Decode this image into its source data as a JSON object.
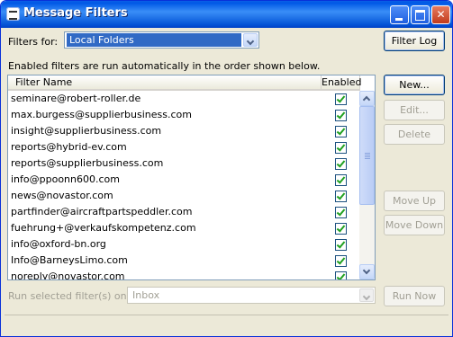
{
  "window": {
    "title": "Message Filters",
    "app_icon": "thunderbird-filter-icon"
  },
  "filters_for": {
    "label": "Filters for:",
    "selected": "Local Folders"
  },
  "filter_log_button": "Filter Log",
  "description": "Enabled filters are run automatically in the order shown below.",
  "list": {
    "columns": {
      "name": "Filter Name",
      "enabled": "Enabled"
    },
    "rows": [
      {
        "name": "seminare@robert-roller.de",
        "enabled": true
      },
      {
        "name": "max.burgess@supplierbusiness.com",
        "enabled": true
      },
      {
        "name": "insight@supplierbusiness.com",
        "enabled": true
      },
      {
        "name": "reports@hybrid-ev.com",
        "enabled": true
      },
      {
        "name": "reports@supplierbusiness.com",
        "enabled": true
      },
      {
        "name": "info@ppoonn600.com",
        "enabled": true
      },
      {
        "name": "news@novastor.com",
        "enabled": true
      },
      {
        "name": "partfinder@aircraftpartspeddler.com",
        "enabled": true
      },
      {
        "name": "fuehrung+@verkaufskompetenz.com",
        "enabled": true
      },
      {
        "name": "info@oxford-bn.org",
        "enabled": true
      },
      {
        "name": "Info@BarneysLimo.com",
        "enabled": true
      },
      {
        "name": "noreply@novastor.com",
        "enabled": true
      }
    ]
  },
  "buttons": {
    "new": "New...",
    "edit": "Edit...",
    "delete": "Delete",
    "move_up": "Move Up",
    "move_down": "Move Down",
    "run_now": "Run Now"
  },
  "run_selected": {
    "label": "Run selected filter(s) on:",
    "selected": "Inbox"
  },
  "colors": {
    "titlebar": "#0058e6",
    "window_bg": "#ece9d8",
    "selection": "#316ac5"
  }
}
